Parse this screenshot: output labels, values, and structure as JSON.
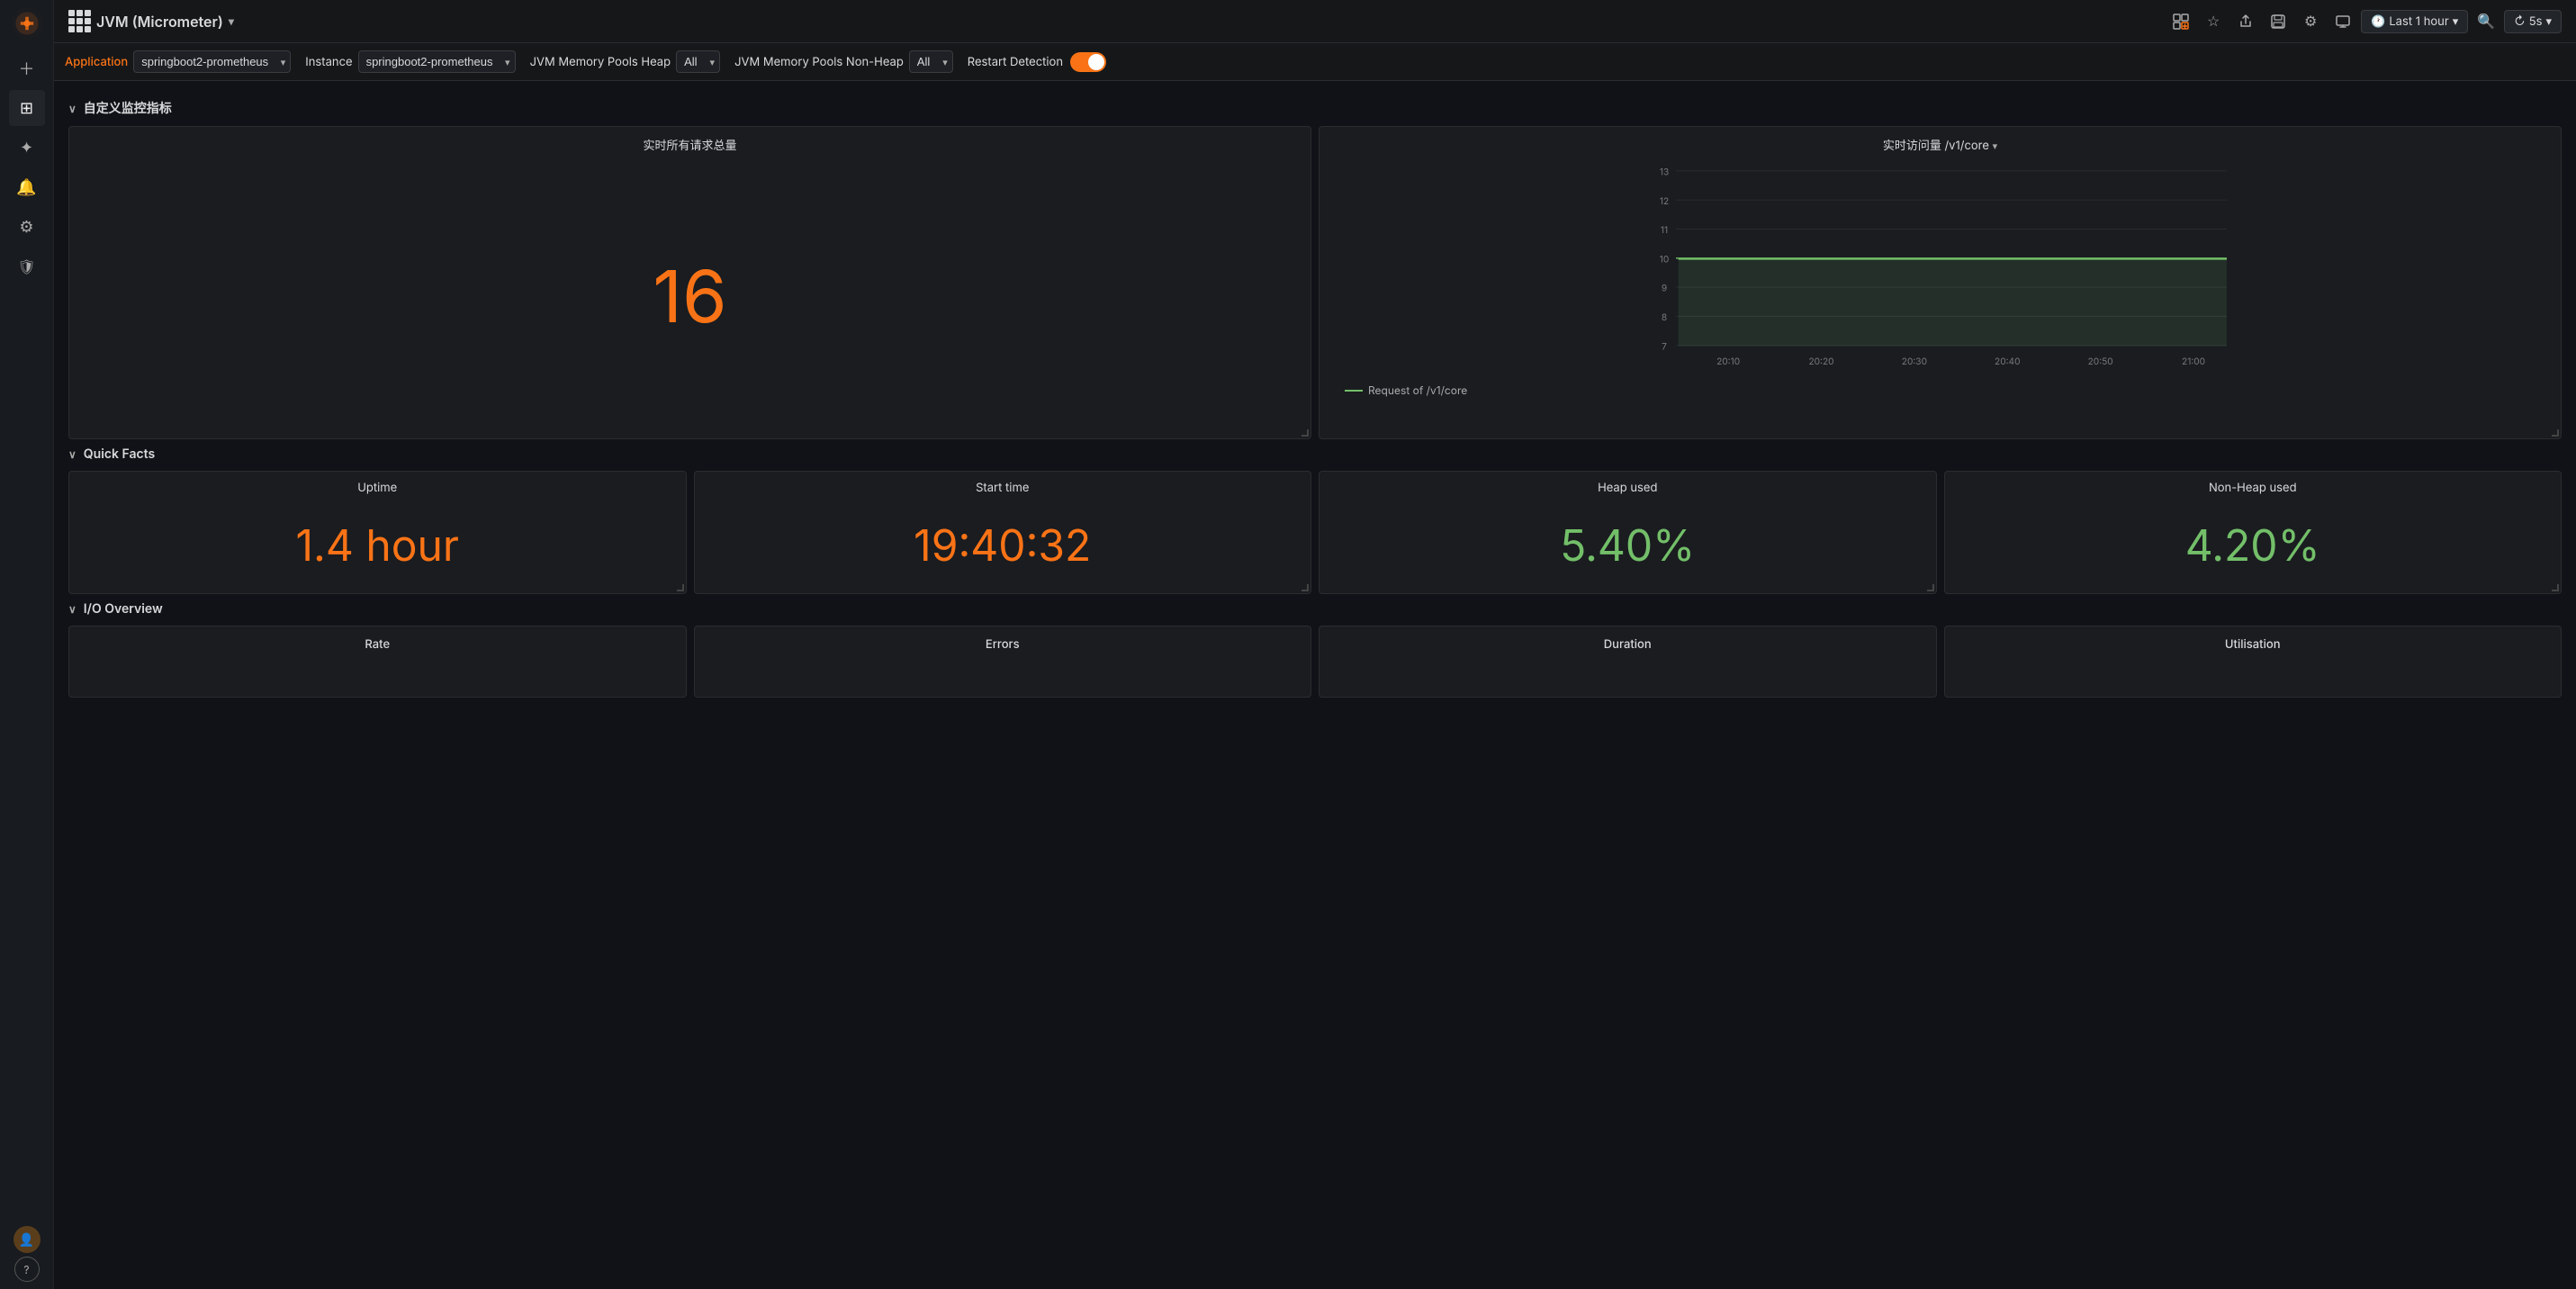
{
  "app": {
    "title": "JVM (Micrometer)",
    "dropdown_icon": "▾"
  },
  "topbar": {
    "actions": {
      "add_panel": "＋",
      "star": "☆",
      "share": "↑",
      "save": "💾",
      "settings": "⚙",
      "tv_mode": "🖥",
      "time_range": "Last 1 hour",
      "time_icon": "🕐",
      "zoom": "🔍",
      "refresh": "5s",
      "refresh_icon": "↻"
    }
  },
  "filterbar": {
    "application_label": "Application",
    "application_value": "springboot2-prometheus",
    "instance_label": "Instance",
    "instance_value": "springboot2-prometheus",
    "jvm_heap_label": "JVM Memory Pools Heap",
    "jvm_heap_value": "All",
    "jvm_nonheap_label": "JVM Memory Pools Non-Heap",
    "jvm_nonheap_value": "All",
    "restart_detection_label": "Restart Detection"
  },
  "custom_section": {
    "title": "自定义监控指标",
    "collapse": "∨"
  },
  "stat_panel": {
    "title": "实时所有请求总量",
    "value": "16"
  },
  "chart_panel": {
    "title": "实时访问量 /v1/core",
    "dropdown": "▾",
    "y_labels": [
      "13",
      "12",
      "11",
      "10",
      "9",
      "8",
      "7"
    ],
    "x_labels": [
      "20:10",
      "20:20",
      "20:30",
      "20:40",
      "20:50",
      "21:00"
    ],
    "legend_label": "Request of /v1/core"
  },
  "quick_facts": {
    "section_title": "Quick Facts",
    "collapse": "∨",
    "panels": [
      {
        "title": "Uptime",
        "value": "1.4 hour",
        "color": "orange"
      },
      {
        "title": "Start time",
        "value": "19:40:32",
        "color": "orange"
      },
      {
        "title": "Heap used",
        "value": "5.40%",
        "color": "green"
      },
      {
        "title": "Non-Heap used",
        "value": "4.20%",
        "color": "green"
      }
    ]
  },
  "io_overview": {
    "section_title": "I/O Overview",
    "collapse": "∨",
    "panels": [
      {
        "title": "Rate"
      },
      {
        "title": "Errors"
      },
      {
        "title": "Duration"
      },
      {
        "title": "Utilisation"
      }
    ]
  },
  "sidebar": {
    "icons": [
      {
        "name": "plus-icon",
        "symbol": "+",
        "interactable": true
      },
      {
        "name": "grid-icon",
        "symbol": "⊞",
        "interactable": true
      },
      {
        "name": "compass-icon",
        "symbol": "◎",
        "interactable": true
      },
      {
        "name": "bell-icon",
        "symbol": "🔔",
        "interactable": true
      },
      {
        "name": "gear-icon",
        "symbol": "⚙",
        "interactable": true
      },
      {
        "name": "shield-icon",
        "symbol": "🛡",
        "interactable": true
      }
    ],
    "bottom": [
      {
        "name": "avatar",
        "symbol": "👤"
      },
      {
        "name": "help-icon",
        "symbol": "?"
      }
    ]
  }
}
